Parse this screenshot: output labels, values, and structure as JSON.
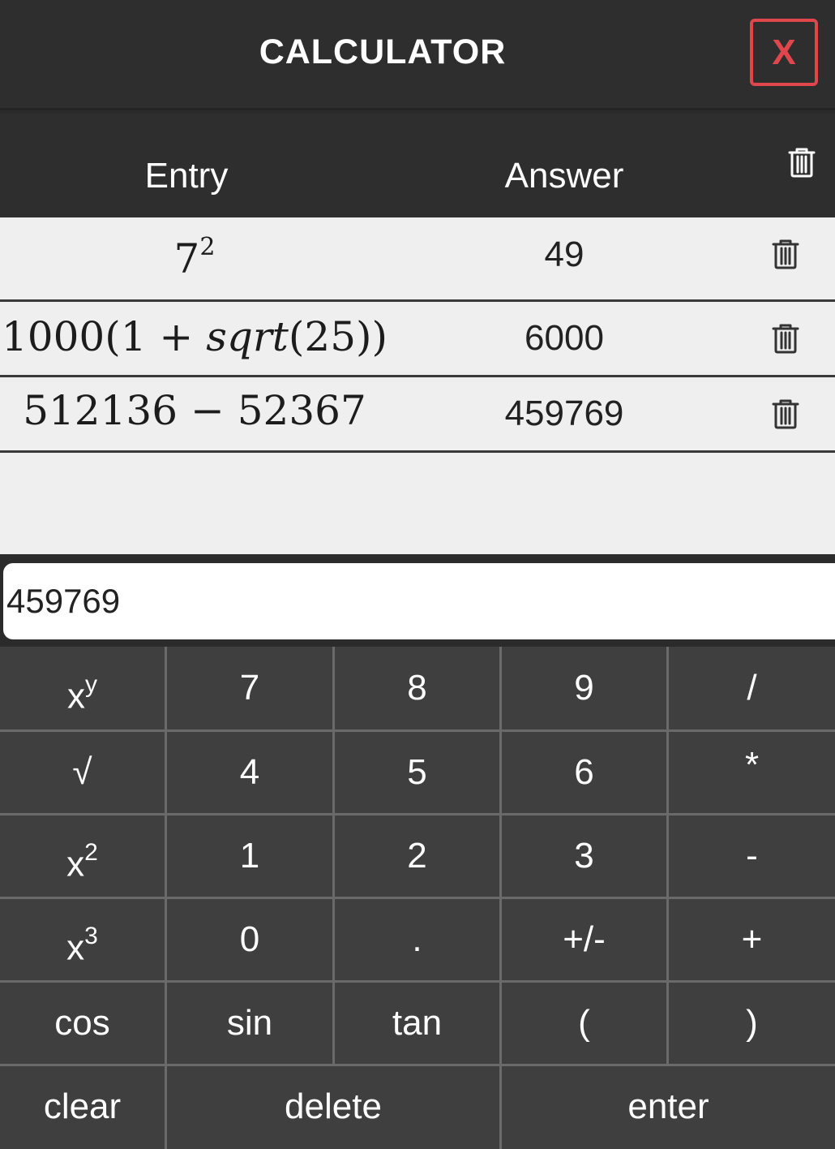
{
  "window": {
    "title": "CALCULATOR",
    "close_label": "X"
  },
  "history": {
    "header": {
      "entry_label": "Entry",
      "answer_label": "Answer",
      "clear_all_icon": "trash-icon"
    },
    "rows": [
      {
        "entry_base": "7",
        "entry_sup": "2",
        "answer": "49"
      },
      {
        "entry_pre": "1000(1 + ",
        "entry_func": "sqrt",
        "entry_post": "(25))",
        "answer": "6000"
      },
      {
        "entry_text": "512136 − 52367",
        "answer": "459769"
      }
    ],
    "row_delete_icon": "trash-icon"
  },
  "display": {
    "value": "459769"
  },
  "keypad": {
    "row1": {
      "c1_base": "x",
      "c1_sup": "y",
      "c2": "7",
      "c3": "8",
      "c4": "9",
      "c5": "/"
    },
    "row2": {
      "c1": "√",
      "c2": "4",
      "c3": "5",
      "c4": "6",
      "c5": "*"
    },
    "row3": {
      "c1_base": "x",
      "c1_sup": "2",
      "c2": "1",
      "c3": "2",
      "c4": "3",
      "c5": "-"
    },
    "row4": {
      "c1_base": "x",
      "c1_sup": "3",
      "c2": "0",
      "c3": ".",
      "c4": "+/-",
      "c5": "+"
    },
    "row5": {
      "c1": "cos",
      "c2": "sin",
      "c3": "tan",
      "c4": "(",
      "c5": ")"
    },
    "row6": {
      "c1": "clear",
      "c2": "delete",
      "c3": "enter"
    }
  },
  "colors": {
    "background_dark": "#2e2e2e",
    "keypad": "#3f3f3f",
    "history_bg": "#efefef",
    "close_accent": "#e0474c",
    "text_light": "#ffffff"
  }
}
